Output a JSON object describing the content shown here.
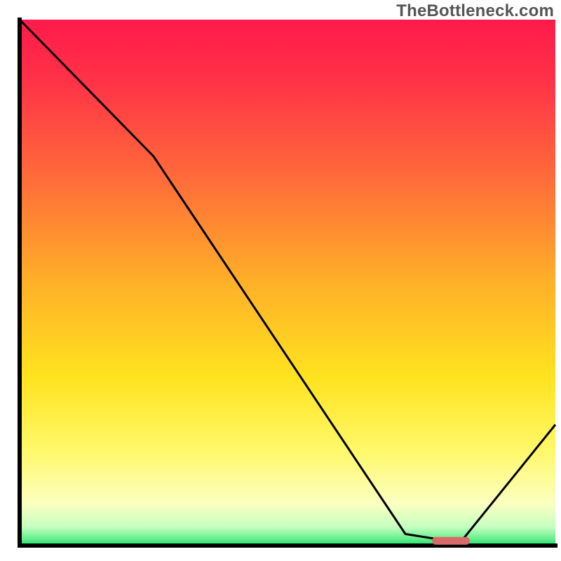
{
  "watermark": "TheBottleneck.com",
  "chart_data": {
    "type": "line",
    "title": "",
    "xlabel": "",
    "ylabel": "",
    "xlim": [
      0,
      100
    ],
    "ylim": [
      0,
      100
    ],
    "grid": false,
    "legend": false,
    "series": [
      {
        "name": "bottleneck-curve",
        "x": [
          0,
          25,
          72,
          80,
          82.5,
          100
        ],
        "values": [
          100,
          74,
          2.2,
          0.9,
          0.9,
          23
        ],
        "color": "#000000"
      }
    ],
    "annotations": [
      {
        "name": "optimal-marker",
        "type": "bar",
        "x_range": [
          77,
          84
        ],
        "y": 0.9,
        "color": "#d86a6a"
      }
    ],
    "background": {
      "type": "vertical-gradient",
      "stops": [
        {
          "pos": 0.0,
          "color": "#ff1a4b"
        },
        {
          "pos": 0.12,
          "color": "#ff3347"
        },
        {
          "pos": 0.3,
          "color": "#ff6b3a"
        },
        {
          "pos": 0.5,
          "color": "#ffb028"
        },
        {
          "pos": 0.68,
          "color": "#ffe31f"
        },
        {
          "pos": 0.82,
          "color": "#fff86a"
        },
        {
          "pos": 0.92,
          "color": "#fbffc0"
        },
        {
          "pos": 0.965,
          "color": "#c4ffc0"
        },
        {
          "pos": 0.985,
          "color": "#70f090"
        },
        {
          "pos": 1.0,
          "color": "#19e36f"
        }
      ]
    },
    "axis_stroke": "#000000",
    "axis_width": 6
  }
}
